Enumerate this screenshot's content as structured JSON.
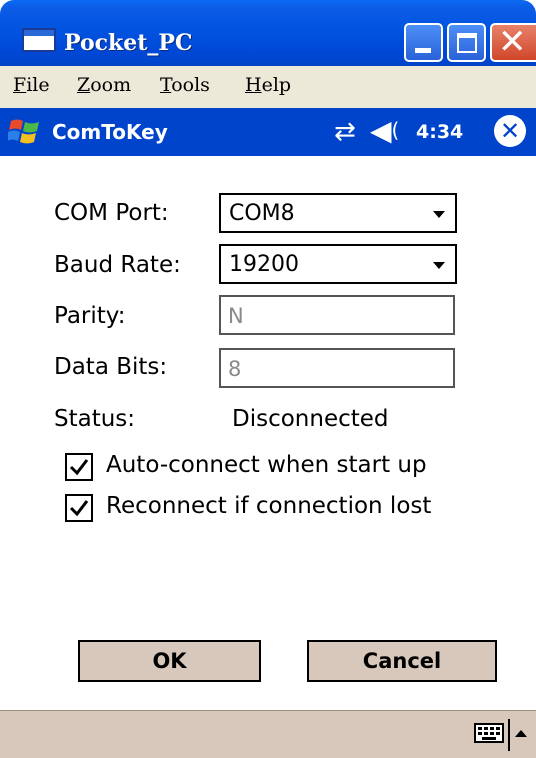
{
  "window": {
    "title": "Pocket_PC"
  },
  "menubar": {
    "items": [
      {
        "key": "F",
        "rest": "ile"
      },
      {
        "key": "Z",
        "rest": "oom"
      },
      {
        "key": "T",
        "rest": "ools"
      },
      {
        "key": "H",
        "rest": "elp"
      }
    ]
  },
  "navbar": {
    "app_title": "ComToKey",
    "time": "4:34"
  },
  "form": {
    "com_port": {
      "label": "COM Port:",
      "value": "COM8"
    },
    "baud_rate": {
      "label": "Baud Rate:",
      "value": "19200"
    },
    "parity": {
      "label": "Parity:",
      "value": "N"
    },
    "data_bits": {
      "label": "Data Bits:",
      "value": "8"
    },
    "status": {
      "label": "Status:",
      "value": "Disconnected"
    },
    "auto_connect": {
      "label": "Auto-connect when start up",
      "checked": true
    },
    "reconnect": {
      "label": "Reconnect if connection lost",
      "checked": true
    }
  },
  "buttons": {
    "ok": "OK",
    "cancel": "Cancel"
  },
  "icons": {
    "app": "window-icon",
    "minimize": "minimize-icon",
    "maximize": "maximize-icon",
    "close": "close-icon",
    "start": "windows-flag-icon",
    "sync": "sync-arrows-icon",
    "sound": "speaker-icon",
    "app_close": "circle-x-icon",
    "keyboard": "keyboard-icon",
    "sip": "up-arrow-icon"
  },
  "colors": {
    "titlebar": "#0054e3",
    "navbar": "#0044cc",
    "bottombar": "#d8c8bc",
    "close_button": "#d0462a"
  }
}
